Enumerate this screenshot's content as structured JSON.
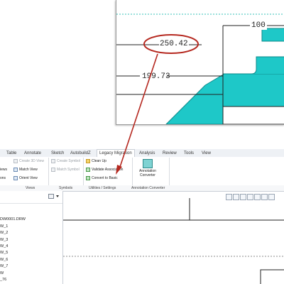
{
  "ribbon": {
    "tabs": [
      {
        "label": "Table"
      },
      {
        "label": "Annotate"
      },
      {
        "label": "Sketch"
      },
      {
        "label": "AutobuildZ"
      },
      {
        "label": "Legacy Migration",
        "active": true
      },
      {
        "label": "Analysis"
      },
      {
        "label": "Review"
      },
      {
        "label": "Tools"
      },
      {
        "label": "View"
      }
    ],
    "views_group": {
      "partial_views_label": "iews",
      "partial_ons_label": "ons",
      "create_3d_view": "Create 3D View",
      "match_view": "Match View",
      "orient_view": "Orient View",
      "label": "Views"
    },
    "symbols_group": {
      "create_symbol": "Create Symbol",
      "match_symbol": "Match Symbol",
      "label": "Symbols"
    },
    "utilities_group": {
      "clean_up": "Clean Up",
      "validate_association": "Validate Association",
      "convert_to_basic": "Convert to Basic",
      "label": "Utilities / Settings"
    },
    "annotation_group": {
      "annotation_converter": "Annotation Converter",
      "label": "Annotation Converter"
    }
  },
  "tree": {
    "items": [
      "DW0001.DRW",
      "W_1",
      "W_2",
      "W_3",
      "W_4",
      "W_5",
      "W_6",
      "W_7",
      "W",
      "_76"
    ]
  },
  "inset": {
    "dimension_highlighted": "250.42",
    "dimension_left": "199.73",
    "dimension_right": "100"
  },
  "colors": {
    "accent_red": "#b5281f",
    "cyan_fill": "#1ec8c8",
    "dash_cyan": "#35c0b8"
  }
}
